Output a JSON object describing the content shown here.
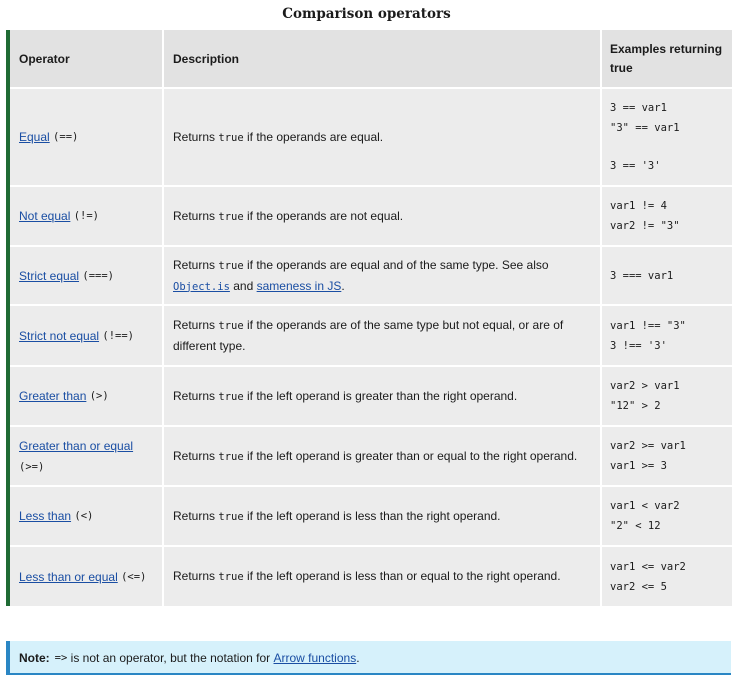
{
  "caption": "Comparison operators",
  "headers": {
    "operator": "Operator",
    "description": "Description",
    "examples_line1": "Examples returning",
    "examples_line2": "true"
  },
  "rows": [
    {
      "name": "Equal",
      "symbol": "(==)",
      "desc_pre": "Returns",
      "desc_code": "true",
      "desc_post": "if the operands are equal.",
      "examples": [
        "3 == var1",
        "\"3\" == var1",
        "3 == '3'"
      ]
    },
    {
      "name": "Not equal",
      "symbol": "(!=)",
      "desc_pre": "Returns",
      "desc_code": "true",
      "desc_post": "if the operands are not equal.",
      "examples": [
        "var1 != 4",
        "var2 != \"3\""
      ]
    },
    {
      "name": "Strict equal",
      "symbol": "(===)",
      "desc_pre": "Returns",
      "desc_code": "true",
      "desc_post": "if the operands are equal and of the same type. See also",
      "desc_link1": "Object.is",
      "desc_and": "and",
      "desc_link2": "sameness in JS",
      "desc_end": ".",
      "examples": [
        "3 === var1"
      ]
    },
    {
      "name": "Strict not equal",
      "symbol": "(!==)",
      "desc_pre": "Returns",
      "desc_code": "true",
      "desc_post": "if the operands are of the same type but not equal, or are of different type.",
      "examples": [
        "var1 !== \"3\"",
        "3 !== '3'"
      ]
    },
    {
      "name": "Greater than",
      "symbol": "(>)",
      "desc_pre": "Returns",
      "desc_code": "true",
      "desc_post": "if the left operand is greater than the right operand.",
      "examples": [
        "var2 > var1",
        "\"12\" > 2"
      ]
    },
    {
      "name": "Greater than or equal",
      "symbol": "(>=)",
      "desc_pre": "Returns",
      "desc_code": "true",
      "desc_post": "if the left operand is greater than or equal to the right operand.",
      "examples": [
        "var2 >= var1",
        "var1 >= 3"
      ]
    },
    {
      "name": "Less than",
      "symbol": "(<)",
      "desc_pre": "Returns",
      "desc_code": "true",
      "desc_post": "if the left operand is less than the right operand.",
      "examples": [
        "var1 < var2",
        "\"2\" < 12"
      ]
    },
    {
      "name": "Less than or equal",
      "symbol": "(<=)",
      "desc_pre": "Returns",
      "desc_code": "true",
      "desc_post": "if the left operand is less than or equal to the right operand.",
      "examples": [
        "var1 <= var2",
        "var2 <= 5"
      ]
    }
  ],
  "note": {
    "label": "Note:",
    "code": "=>",
    "text": "is not an operator, but the notation for",
    "link": "Arrow functions",
    "end": "."
  },
  "colors": {
    "row_bg": "#ececec",
    "header_bg": "#e2e2e2",
    "left_bar": "#1f6b34",
    "link": "#1a4ea3",
    "note_bg": "#d6f1fb",
    "note_accent": "#2a86c4"
  }
}
